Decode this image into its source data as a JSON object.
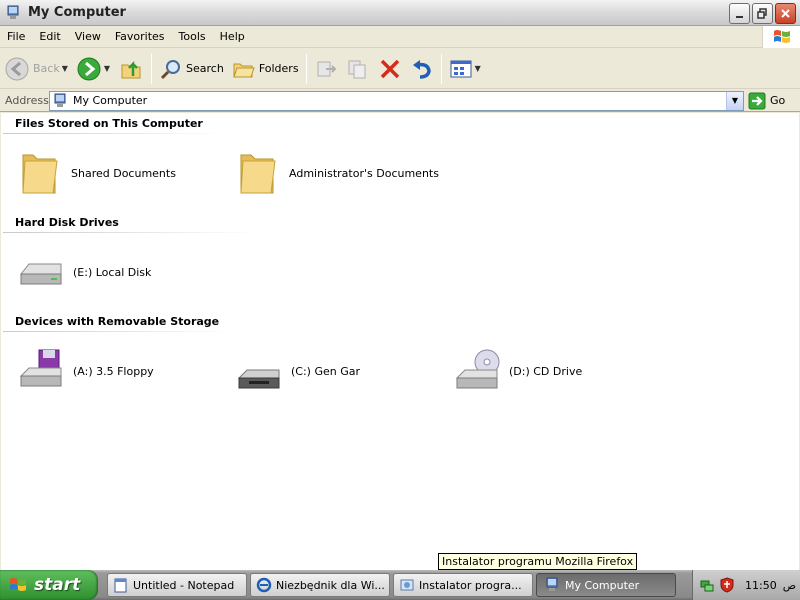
{
  "window": {
    "title": "My Computer",
    "buttons": [
      "minimize",
      "maximize",
      "close"
    ]
  },
  "menubar": {
    "items": [
      "File",
      "Edit",
      "View",
      "Favorites",
      "Tools",
      "Help"
    ]
  },
  "toolbar": {
    "back_label": "Back",
    "search_label": "Search",
    "folders_label": "Folders"
  },
  "address": {
    "label": "Address",
    "value": "My Computer",
    "go_label": "Go"
  },
  "groups": [
    {
      "title": "Files Stored on This Computer",
      "items": [
        {
          "label": "Shared Documents",
          "icon": "folder-icon"
        },
        {
          "label": "Administrator's Documents",
          "icon": "folder-icon"
        }
      ]
    },
    {
      "title": "Hard Disk Drives",
      "items": [
        {
          "label": "(E:) Local Disk",
          "icon": "hard-disk-icon"
        }
      ]
    },
    {
      "title": "Devices with Removable Storage",
      "items": [
        {
          "label": "(A:) 3.5 Floppy",
          "icon": "floppy-drive-icon"
        },
        {
          "label": "(C:) Gen Gar",
          "icon": "removable-drive-icon"
        },
        {
          "label": "(D:) CD Drive",
          "icon": "cd-drive-icon"
        }
      ]
    }
  ],
  "taskbar": {
    "start_label": "start",
    "tasks": [
      {
        "label": "Untitled - Notepad",
        "active": false
      },
      {
        "label": "Niezbędnik dla Wi...",
        "active": false
      },
      {
        "label": "Instalator progra...",
        "active": false
      },
      {
        "label": "My Computer",
        "active": true
      }
    ],
    "clock": "11:50",
    "locale": "ص"
  },
  "tooltip": {
    "text": "Instalator programu Mozilla Firefox"
  },
  "colors": {
    "start_green": "#3a9a3a",
    "address_border": "#7f9db9",
    "delete_red": "#d62a1a",
    "folder_yellow": "#f3d37a"
  }
}
